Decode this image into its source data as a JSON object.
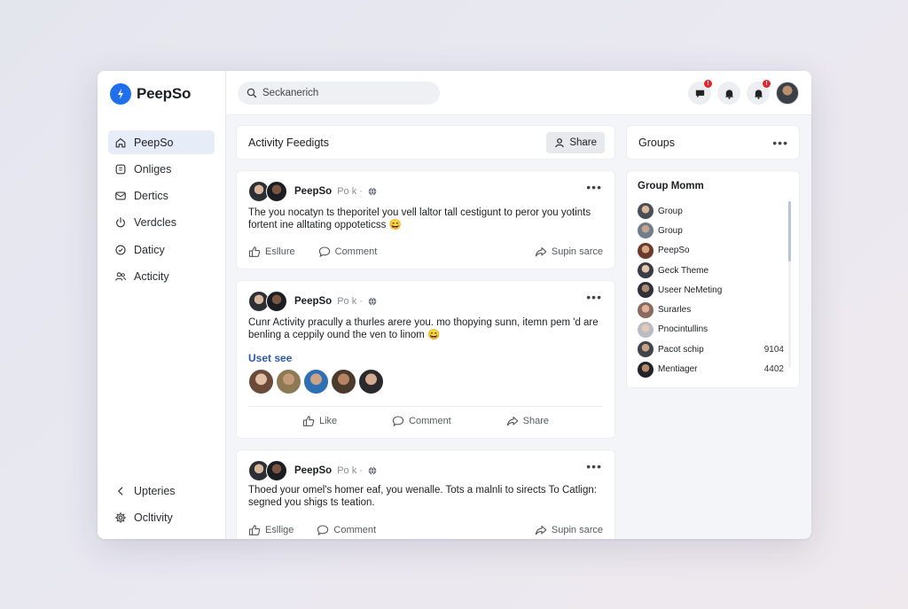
{
  "app": {
    "name": "PeepSo"
  },
  "sidebar": {
    "items": [
      {
        "label": "PeepSo",
        "icon": "home-icon",
        "active": true
      },
      {
        "label": "Onliges",
        "icon": "grid-icon"
      },
      {
        "label": "Dertics",
        "icon": "mail-icon"
      },
      {
        "label": "Verdcles",
        "icon": "power-icon"
      },
      {
        "label": "Daticy",
        "icon": "check-circle-icon"
      },
      {
        "label": "Acticity",
        "icon": "users-icon"
      }
    ],
    "bottom": [
      {
        "label": "Upteries",
        "icon": "chevron-left-icon"
      },
      {
        "label": "Ocltivity",
        "icon": "gear-icon"
      }
    ]
  },
  "topbar": {
    "search_value": "Seckanerich",
    "notification_badges": [
      "!",
      "",
      "!"
    ]
  },
  "feed": {
    "title": "Activity Feedigts",
    "share_label": "Share"
  },
  "posts": [
    {
      "author": "PeepSo",
      "meta": "Po k ·",
      "text": "The you nocatyn ts theporitel you vell laltor tall cestigunt to peror you yotints fortent ine alltating oppoteticss 😄",
      "actions": [
        "Esllure",
        "Comment",
        "Supin sarce"
      ]
    },
    {
      "author": "PeepSo",
      "meta": "Po k ·",
      "text": "Cunr Activity pracully a thurles arere you. mo thopying sunn, itemn pem 'd are benling a ceppily ound the ven to linom 😄",
      "users_label": "Uset see",
      "actions": [
        "Like",
        "Comment",
        "Share"
      ]
    },
    {
      "author": "PeepSo",
      "meta": "Po k ·",
      "text": "Thoed your omel's homer eaf, you wenalle. Tots a malnli to sirects To Catlign: segned you shigs ts teation.",
      "actions": [
        "Esllige",
        "Comment",
        "Supin sarce"
      ]
    }
  ],
  "groups": {
    "title": "Groups",
    "card_title": "Group Momm",
    "items": [
      {
        "name": "Group",
        "count": ""
      },
      {
        "name": "Group",
        "count": ""
      },
      {
        "name": "PeepSo",
        "count": ""
      },
      {
        "name": "Geck Theme",
        "count": ""
      },
      {
        "name": "Useer NeMeting",
        "count": ""
      },
      {
        "name": "Surarles",
        "count": ""
      },
      {
        "name": "Pnocintullins",
        "count": ""
      },
      {
        "name": "Pacot schip",
        "count": "9104"
      },
      {
        "name": "Mentiager",
        "count": "4402"
      }
    ]
  },
  "colors": {
    "brand": "#1f6feb",
    "active_nav_bg": "#e6ecf8",
    "badge": "#e1262c",
    "link": "#2d5aa8"
  }
}
